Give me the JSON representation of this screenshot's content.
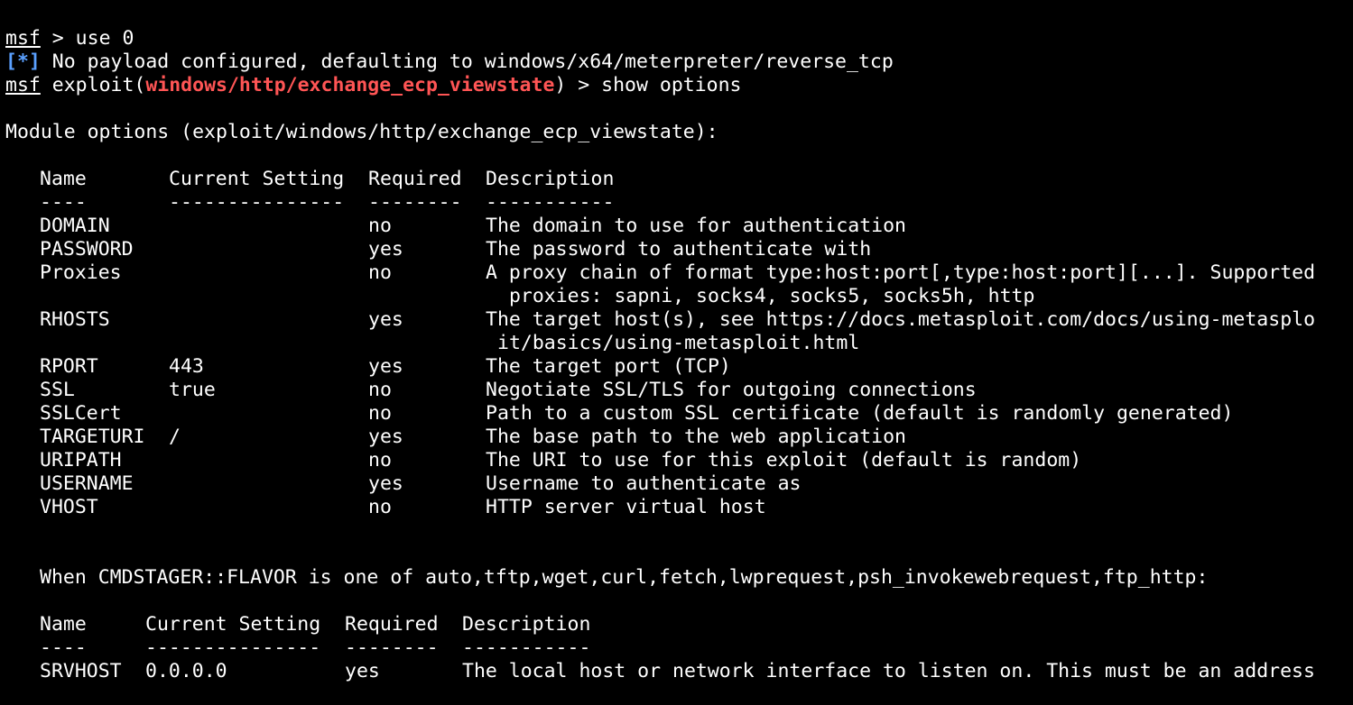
{
  "terminal": {
    "prompt": "msf",
    "command1": " > use 0",
    "info_tag": "[*]",
    "info_msg": " No payload configured, defaulting to windows/x64/meterpreter/reverse_tcp",
    "exploit_prefix": " exploit(",
    "module_name": "windows/http/exchange_ecp_viewstate",
    "command2": ") > show options",
    "module_options_title": "Module options (exploit/windows/http/exchange_ecp_viewstate):",
    "table1": {
      "headers": [
        "Name",
        "Current Setting",
        "Required",
        "Description"
      ],
      "dashes": [
        "----",
        "---------------",
        "--------",
        "-----------"
      ],
      "rows": [
        {
          "name": "DOMAIN",
          "setting": "",
          "required": "no",
          "desc": "The domain to use for authentication"
        },
        {
          "name": "PASSWORD",
          "setting": "",
          "required": "yes",
          "desc": "The password to authenticate with"
        },
        {
          "name": "Proxies",
          "setting": "",
          "required": "no",
          "desc": "A proxy chain of format type:host:port[,type:host:port][...]. Supported",
          "desc2": " proxies: sapni, socks4, socks5, socks5h, http"
        },
        {
          "name": "RHOSTS",
          "setting": "",
          "required": "yes",
          "desc": "The target host(s), see https://docs.metasploit.com/docs/using-metasplo",
          "desc2": "it/basics/using-metasploit.html"
        },
        {
          "name": "RPORT",
          "setting": "443",
          "required": "yes",
          "desc": "The target port (TCP)"
        },
        {
          "name": "SSL",
          "setting": "true",
          "required": "no",
          "desc": "Negotiate SSL/TLS for outgoing connections"
        },
        {
          "name": "SSLCert",
          "setting": "",
          "required": "no",
          "desc": "Path to a custom SSL certificate (default is randomly generated)"
        },
        {
          "name": "TARGETURI",
          "setting": "/",
          "required": "yes",
          "desc": "The base path to the web application"
        },
        {
          "name": "URIPATH",
          "setting": "",
          "required": "no",
          "desc": "The URI to use for this exploit (default is random)"
        },
        {
          "name": "USERNAME",
          "setting": "",
          "required": "yes",
          "desc": "Username to authenticate as"
        },
        {
          "name": "VHOST",
          "setting": "",
          "required": "no",
          "desc": "HTTP server virtual host"
        }
      ]
    },
    "cmdstager_note": "When CMDSTAGER::FLAVOR is one of auto,tftp,wget,curl,fetch,lwprequest,psh_invokewebrequest,ftp_http:",
    "table2": {
      "headers": [
        "Name",
        "Current Setting",
        "Required",
        "Description"
      ],
      "dashes": [
        "----",
        "---------------",
        "--------",
        "-----------"
      ],
      "rows": [
        {
          "name": "SRVHOST",
          "setting": "0.0.0.0",
          "required": "yes",
          "desc": "The local host or network interface to listen on. This must be an address"
        }
      ]
    },
    "colors": {
      "background": "#000000",
      "text": "#ffffff",
      "info": "#5aa0ff",
      "module": "#ff5555"
    }
  }
}
